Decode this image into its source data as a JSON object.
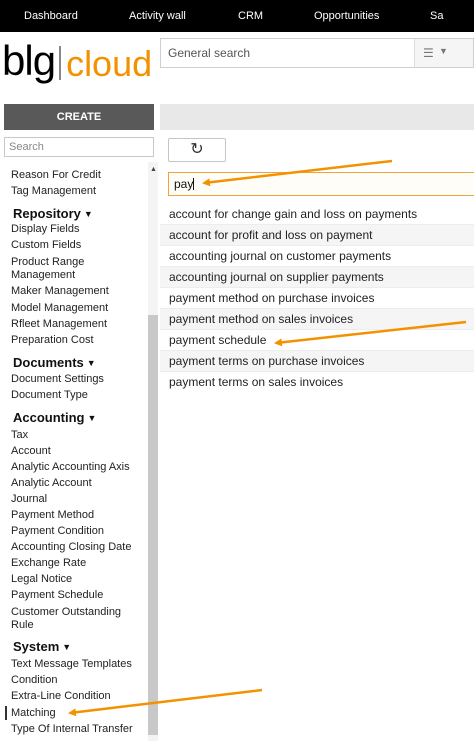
{
  "topnav": {
    "items": [
      "Dashboard",
      "Activity wall",
      "CRM",
      "Opportunities",
      "Sa"
    ]
  },
  "logo": {
    "part1": "blg",
    "part2": "cloud"
  },
  "header": {
    "search_placeholder": "General search",
    "scope_icon": "layers-icon"
  },
  "sidebar": {
    "create_label": "CREATE",
    "search_placeholder": "Search",
    "items_top": [
      "Reason For Credit",
      "Tag Management"
    ],
    "repository": {
      "heading": "Repository",
      "items": [
        "Display Fields",
        "Custom Fields",
        "Product Range Management",
        "Maker Management",
        "Model Management",
        "Rfleet Management",
        "Preparation Cost"
      ]
    },
    "documents": {
      "heading": "Documents",
      "items": [
        "Document Settings",
        "Document Type"
      ]
    },
    "accounting": {
      "heading": "Accounting",
      "items": [
        "Tax",
        "Account",
        "Analytic Accounting Axis",
        "Analytic Account",
        "Journal",
        "Payment Method",
        "Payment Condition",
        "Accounting Closing Date",
        "Exchange Rate",
        "Legal Notice",
        "Payment Schedule",
        "Customer Outstanding Rule"
      ]
    },
    "system": {
      "heading": "System",
      "items": [
        "Text Message Templates",
        "Condition",
        "Extra-Line Condition",
        "Matching",
        "Type Of Internal Transfer"
      ]
    }
  },
  "main": {
    "refresh_icon": "refresh-icon",
    "filter_value": "pay",
    "results": [
      "account for change gain and loss on payments",
      "account for profit and loss on payment",
      "accounting journal on customer payments",
      "accounting journal on supplier payments",
      "payment method on purchase invoices",
      "payment method on sales invoices",
      "payment schedule",
      "payment terms on purchase invoices",
      "payment terms on sales invoices"
    ]
  },
  "colors": {
    "accent": "#f39200",
    "topnav_bg": "#000000",
    "create_bg": "#595959"
  }
}
